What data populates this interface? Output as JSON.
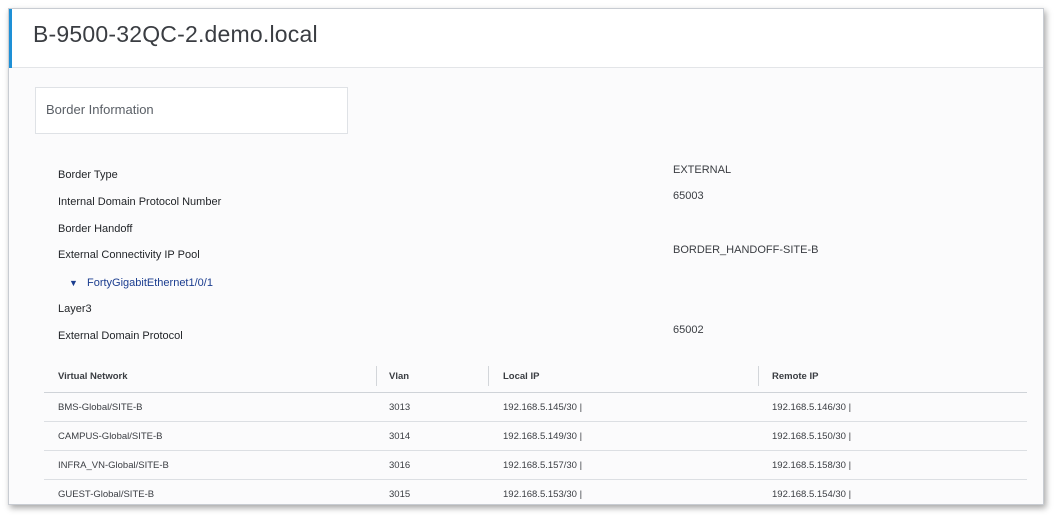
{
  "header": {
    "title": "B-9500-32QC-2.demo.local"
  },
  "section": {
    "title": "Border Information"
  },
  "properties": [
    {
      "label": "Border Type",
      "value": "EXTERNAL"
    },
    {
      "label": "Internal Domain Protocol Number",
      "value": "65003"
    },
    {
      "label": "Border Handoff",
      "value": ""
    },
    {
      "label": "External Connectivity IP Pool",
      "value": "BORDER_HANDOFF-SITE-B"
    }
  ],
  "interface": {
    "name": "FortyGigabitEthernet1/0/1",
    "icon": "chevron-down-icon"
  },
  "layer": {
    "label": "Layer3"
  },
  "external_protocol": {
    "label": "External Domain Protocol",
    "value": "65002"
  },
  "table": {
    "headers": [
      "Virtual Network",
      "Vlan",
      "Local IP",
      "Remote IP"
    ],
    "rows": [
      [
        "BMS-Global/SITE-B",
        "3013",
        "192.168.5.145/30 |",
        "192.168.5.146/30 |"
      ],
      [
        "CAMPUS-Global/SITE-B",
        "3014",
        "192.168.5.149/30 |",
        "192.168.5.150/30 |"
      ],
      [
        "INFRA_VN-Global/SITE-B",
        "3016",
        "192.168.5.157/30 |",
        "192.168.5.158/30 |"
      ],
      [
        "GUEST-Global/SITE-B",
        "3015",
        "192.168.5.153/30 |",
        "192.168.5.154/30 |"
      ]
    ]
  },
  "colors": {
    "accent": "#1e90d6",
    "link": "#1b3d8f"
  }
}
